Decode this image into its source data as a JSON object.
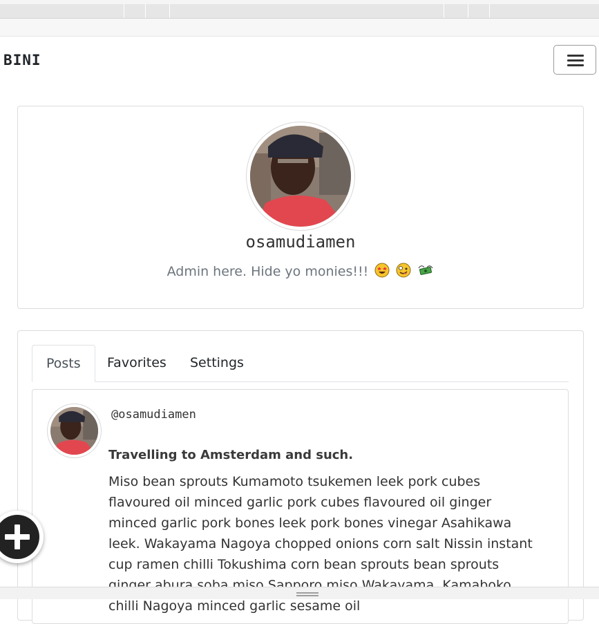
{
  "navbar": {
    "brand": "BINI",
    "menu_icon": "hamburger-menu-icon"
  },
  "profile": {
    "username": "osamudiamen",
    "bio": "Admin here. Hide yo monies!!!",
    "bio_emojis": [
      "star-struck-face-icon",
      "zany-face-icon",
      "money-with-wings-icon"
    ]
  },
  "tabs": [
    {
      "label": "Posts",
      "active": true
    },
    {
      "label": "Favorites",
      "active": false
    },
    {
      "label": "Settings",
      "active": false
    }
  ],
  "post": {
    "handle": "@osamudiamen",
    "title": "Travelling to Amsterdam and such.",
    "body": "Miso bean sprouts Kumamoto tsukemen leek pork cubes flavoured oil minced garlic pork cubes flavoured oil ginger minced garlic pork bones leek pork bones vinegar Asahikawa leek. Wakayama Nagoya chopped onions corn salt Nissin instant cup ramen chilli Tokushima corn bean sprouts bean sprouts ginger abura soba miso Sapporo miso Wakayama. Kamaboko chilli Nagoya minced garlic sesame oil"
  },
  "fab": {
    "icon": "plus-icon"
  },
  "colors": {
    "accent_text": "#212529",
    "muted_text": "#6c757d",
    "border": "#dcdcdc",
    "fab_bg": "#222222"
  }
}
